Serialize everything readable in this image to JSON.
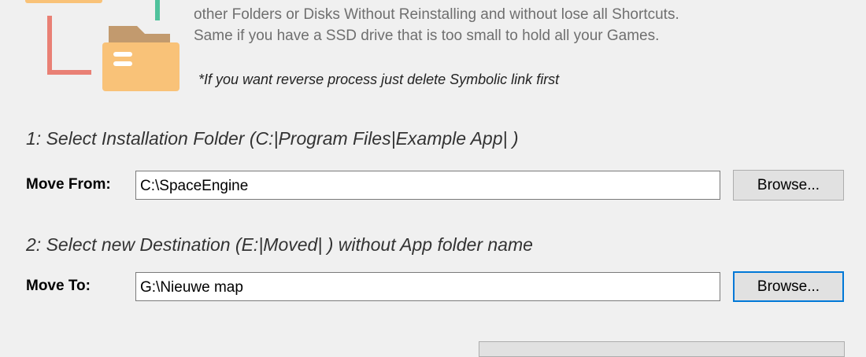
{
  "description": {
    "line1": "other Folders or Disks Without Reinstalling and without lose all Shortcuts.",
    "line2": "Same if you have a SSD drive that is too small to hold all your Games."
  },
  "note": "*If you want reverse process just delete Symbolic link first",
  "step1": {
    "title": "1: Select Installation Folder (C:|Program Files|Example App| )",
    "label": "Move From:",
    "value": "C:\\SpaceEngine",
    "browse_label": "Browse..."
  },
  "step2": {
    "title": "2: Select new Destination (E:|Moved| ) without App folder name",
    "label": "Move To:",
    "value": "G:\\Nieuwe map",
    "browse_label": "Browse..."
  },
  "icons": {
    "illustration": "folder-move-illustration",
    "source_folder": "folder-icon",
    "destination_folder": "folder-document-icon"
  },
  "colors": {
    "folder": "#f9c278",
    "folder_tab": "#c29a6e",
    "arrow_left": "#e98075",
    "arrow_top": "#4fc29c",
    "focus_border": "#0078d7",
    "description_text": "#6f6f6f"
  }
}
